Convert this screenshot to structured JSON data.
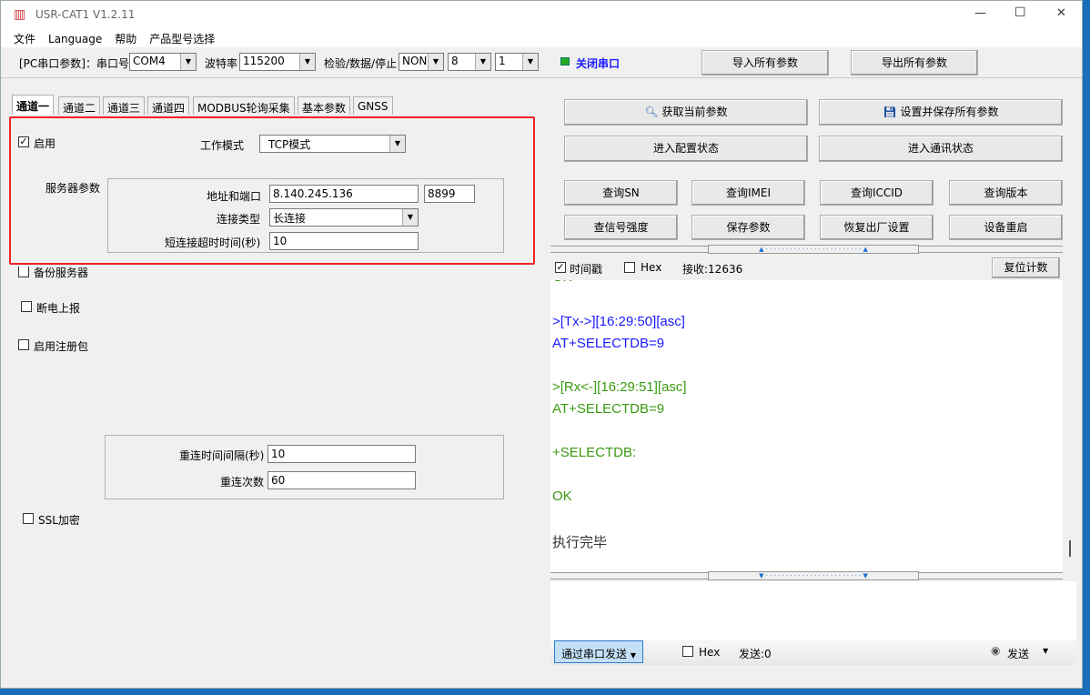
{
  "window": {
    "title": "USR-CAT1 V1.2.11",
    "controls": [
      "—",
      "☐",
      "✕"
    ]
  },
  "menu": [
    "文件",
    "Language",
    "帮助",
    "产品型号选择"
  ],
  "toolbar": {
    "pc_label": "[PC串口参数]：串口号",
    "port": "COM4",
    "baud_label": "波特率",
    "baud": "115200",
    "parity_label": "检验/数据/停止",
    "parity": "NONI",
    "data_bits": "8",
    "stop_bits": "1",
    "close_port": "关闭串口",
    "import": "导入所有参数",
    "export": "导出所有参数",
    "status_color": "#22aa22"
  },
  "tabs": [
    "通道一",
    "通道二",
    "通道三",
    "通道四",
    "MODBUS轮询采集",
    "基本参数",
    "GNSS"
  ],
  "channel": {
    "enable": "启用",
    "work_mode_label": "工作模式",
    "work_mode": "TCP模式",
    "server_params": "服务器参数",
    "addr_label": "地址和端口",
    "addr": "8.140.245.136",
    "port": "8899",
    "conn_type_label": "连接类型",
    "conn_type": "长连接",
    "short_timeout_label": "短连接超时时间(秒)",
    "short_timeout": "10",
    "backup": "备份服务器",
    "power_report": "断电上报",
    "reg_packet": "启用注册包",
    "reconnect_interval_label": "重连时间间隔(秒)",
    "reconnect_interval": "10",
    "reconnect_count_label": "重连次数",
    "reconnect_count": "60",
    "ssl": "SSL加密"
  },
  "actions": {
    "get_params": "获取当前参数",
    "save_all": "设置并保存所有参数",
    "enter_config": "进入配置状态",
    "enter_comm": "进入通讯状态",
    "query_sn": "查询SN",
    "query_imei": "查询IMEI",
    "query_iccid": "查询ICCID",
    "query_version": "查询版本",
    "query_signal": "查信号强度",
    "save_params": "保存参数",
    "factory_reset": "恢复出厂设置",
    "reboot": "设备重启"
  },
  "receive": {
    "timestamp": "时间戳",
    "hex": "Hex",
    "count": "接收:12636",
    "reset": "复位计数"
  },
  "log": [
    {
      "text": "OK",
      "color": "#3a9a10"
    },
    {
      "text": ">[Tx->][16:29:50][asc]",
      "color": "#1a1aff"
    },
    {
      "text": "AT+SELECTDB=9",
      "color": "#1a1aff"
    },
    {
      "text": ">[Rx<-][16:29:51][asc]",
      "color": "#3a9a10"
    },
    {
      "text": "AT+SELECTDB=9",
      "color": "#3a9a10"
    },
    {
      "text": "+SELECTDB:",
      "color": "#3a9a10"
    },
    {
      "text": "OK",
      "color": "#3a9a10"
    },
    {
      "text": "执行完毕",
      "color": "#333333"
    }
  ],
  "send": {
    "via": "通过串口发送",
    "hex": "Hex",
    "count": "发送:0",
    "send": "发送"
  },
  "highlight_color": "#ee2222"
}
